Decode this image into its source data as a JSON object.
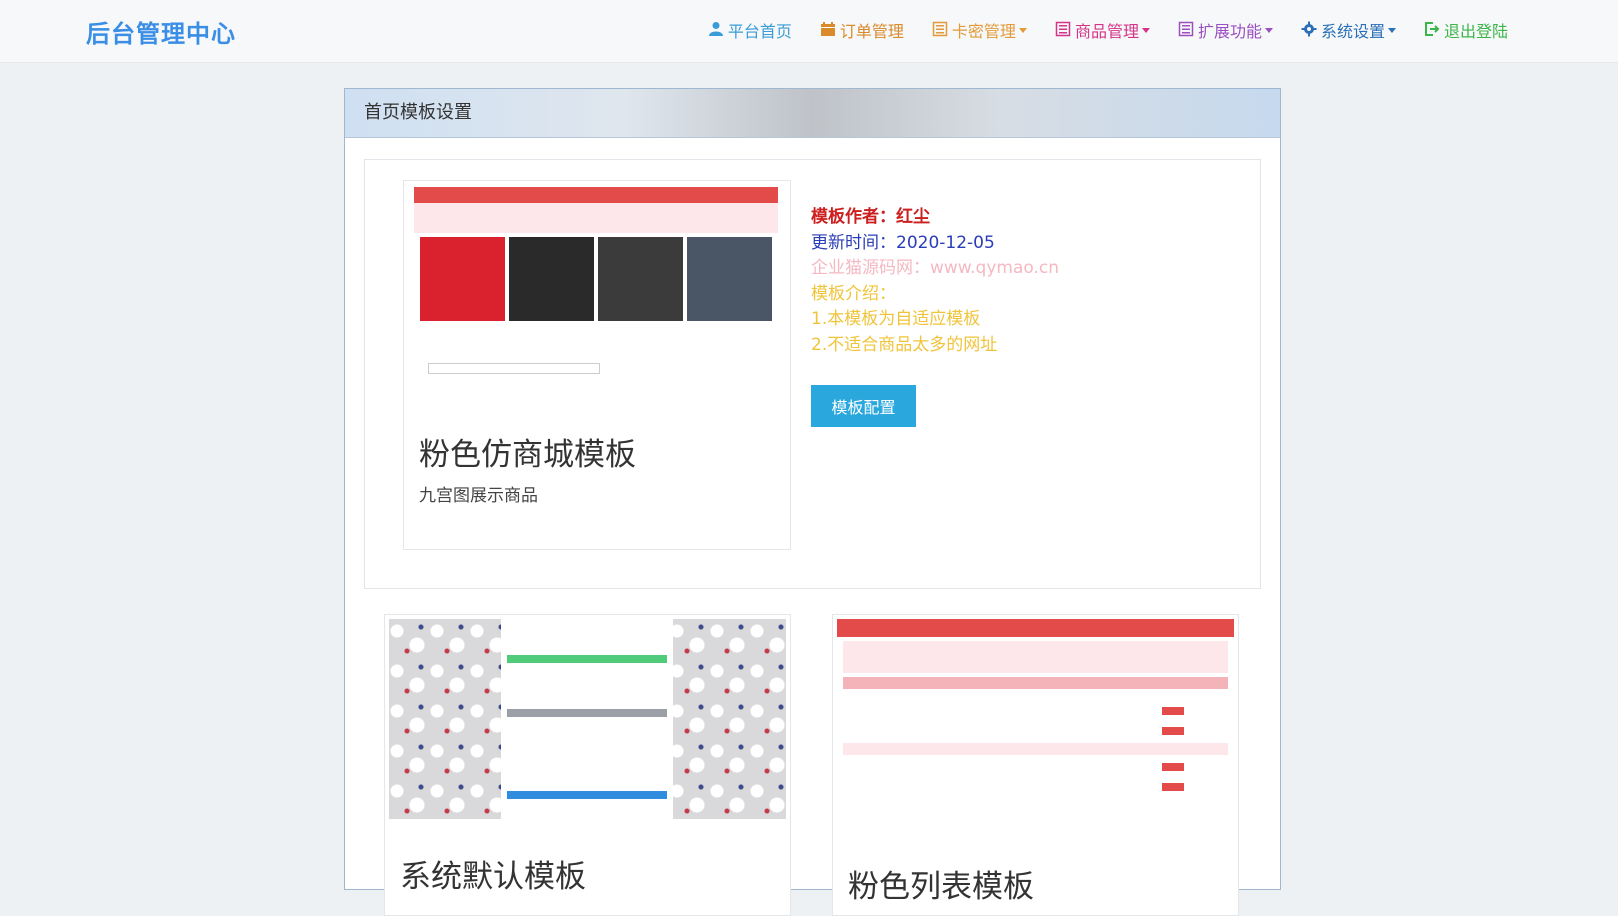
{
  "navbar": {
    "brand": "后台管理中心",
    "items": [
      {
        "label": "平台首页",
        "icon": "user-icon",
        "color": "#3a9bd9",
        "dropdown": false
      },
      {
        "label": "订单管理",
        "icon": "calendar-icon",
        "color": "#d98a2b",
        "dropdown": false
      },
      {
        "label": "卡密管理",
        "icon": "list-icon",
        "color": "#e29a3a",
        "dropdown": true
      },
      {
        "label": "商品管理",
        "icon": "list-icon",
        "color": "#d6338a",
        "dropdown": true
      },
      {
        "label": "扩展功能",
        "icon": "list-icon",
        "color": "#9b4fc1",
        "dropdown": true
      },
      {
        "label": "系统设置",
        "icon": "gear-icon",
        "color": "#2a6fb8",
        "dropdown": true
      },
      {
        "label": "退出登陆",
        "icon": "logout-icon",
        "color": "#3cb64a",
        "dropdown": false
      }
    ]
  },
  "panel": {
    "title": "首页模板设置",
    "featured": {
      "name": "粉色仿商城模板",
      "desc": "九宫图展示商品",
      "author_label": "模板作者：",
      "author": "红尘",
      "updated_label": "更新时间：",
      "updated": "2020-12-05",
      "watermark": "企业猫源码网：www.qymao.cn",
      "intro_label": "模板介绍：",
      "intro_lines": [
        "1.本模板为自适应模板",
        "2.不适合商品太多的网址"
      ],
      "config_button": "模板配置"
    },
    "others": [
      {
        "name": "系统默认模板"
      },
      {
        "name": "粉色列表模板"
      }
    ]
  },
  "colors": {
    "author": "#cc1f1f",
    "updated": "#2a3db8",
    "watermark": "#f4b8c2",
    "intro": "#f0c43a",
    "button": "#2aa7dc"
  }
}
